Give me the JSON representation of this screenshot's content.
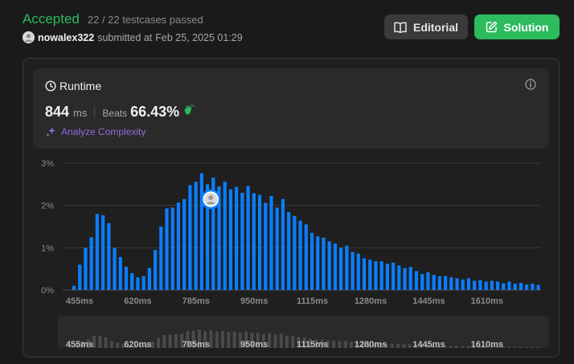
{
  "status": {
    "title": "Accepted",
    "testcases": "22 / 22 testcases passed"
  },
  "submission": {
    "username": "nowalex322",
    "submitted_label": "submitted at",
    "timestamp": "Feb 25, 2025 01:29"
  },
  "buttons": {
    "editorial": "Editorial",
    "solution": "Solution"
  },
  "runtime": {
    "title": "Runtime",
    "value": "844",
    "unit": "ms",
    "beats_label": "Beats",
    "beats_value": "66.43%",
    "analyze_label": "Analyze Complexity"
  },
  "colors": {
    "accepted": "#2cbb5d",
    "bar": "#0a7eff",
    "mini_bar": "#4a4a4a",
    "analyze": "#8f6dde"
  },
  "icons": {
    "avatar": "avatar-icon",
    "editorial": "book-icon",
    "solution": "edit-icon",
    "runtime": "clock-icon",
    "info": "info-icon",
    "beats": "clap-icon",
    "analyze": "sparkle-icon",
    "marker": "user-marker-icon"
  },
  "chart_data": {
    "type": "bar",
    "title": "",
    "xlabel": "",
    "ylabel": "",
    "ylim": [
      0,
      3
    ],
    "y_ticks": [
      "0%",
      "1%",
      "2%",
      "3%"
    ],
    "x_tick_labels": [
      "455ms",
      "620ms",
      "785ms",
      "950ms",
      "1115ms",
      "1280ms",
      "1445ms",
      "1610ms"
    ],
    "x_range_ms": [
      455,
      1712
    ],
    "bin_width_ms": 16.5,
    "values": [
      0.1,
      0.6,
      1.0,
      1.25,
      1.8,
      1.77,
      1.58,
      1.0,
      0.78,
      0.55,
      0.4,
      0.3,
      0.33,
      0.52,
      0.95,
      1.5,
      1.93,
      1.95,
      2.07,
      2.15,
      2.48,
      2.56,
      2.76,
      2.5,
      2.66,
      2.45,
      2.56,
      2.38,
      2.44,
      2.3,
      2.46,
      2.29,
      2.25,
      2.06,
      2.22,
      1.95,
      2.15,
      1.84,
      1.75,
      1.64,
      1.55,
      1.35,
      1.27,
      1.24,
      1.15,
      1.1,
      1.0,
      1.05,
      0.9,
      0.86,
      0.75,
      0.72,
      0.68,
      0.68,
      0.62,
      0.65,
      0.58,
      0.52,
      0.55,
      0.45,
      0.38,
      0.42,
      0.36,
      0.33,
      0.33,
      0.3,
      0.28,
      0.25,
      0.28,
      0.22,
      0.24,
      0.2,
      0.22,
      0.2,
      0.16,
      0.2,
      0.15,
      0.17,
      0.13,
      0.15,
      0.12
    ],
    "highlight_ms": 844,
    "grid": true,
    "legend": "none"
  }
}
